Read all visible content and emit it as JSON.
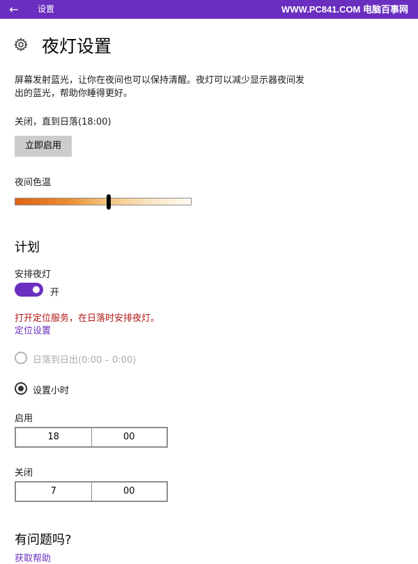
{
  "titlebar": {
    "back_icon": "←",
    "app_name": "设置",
    "watermark": "WWW.PC841.COM 电脑百事网",
    "accent": "#6b2fbf"
  },
  "page": {
    "title": "夜灯设置",
    "description": "屏幕发射蓝光，让你在夜间也可以保持清醒。夜灯可以减少显示器夜间发出的蓝光，帮助你睡得更好。",
    "status": "关闭，直到日落(18:00)",
    "enable_now_button": "立即启用"
  },
  "color_temp": {
    "label": "夜间色温",
    "level": 0.53
  },
  "schedule": {
    "heading": "计划",
    "schedule_label": "安排夜灯",
    "toggle_on": true,
    "toggle_state_text": "开",
    "location_warning": "打开定位服务，在日落时安排夜灯。",
    "location_link": "定位设置",
    "options": [
      {
        "label": "日落到日出(0:00 – 0:00)",
        "selected": false,
        "disabled": true
      },
      {
        "label": "设置小时",
        "selected": true,
        "disabled": false
      }
    ],
    "turn_on": {
      "label": "启用",
      "hour": "18",
      "minute": "00"
    },
    "turn_off": {
      "label": "关闭",
      "hour": "7",
      "minute": "00"
    }
  },
  "help": {
    "heading": "有问题吗?",
    "link": "获取帮助"
  }
}
